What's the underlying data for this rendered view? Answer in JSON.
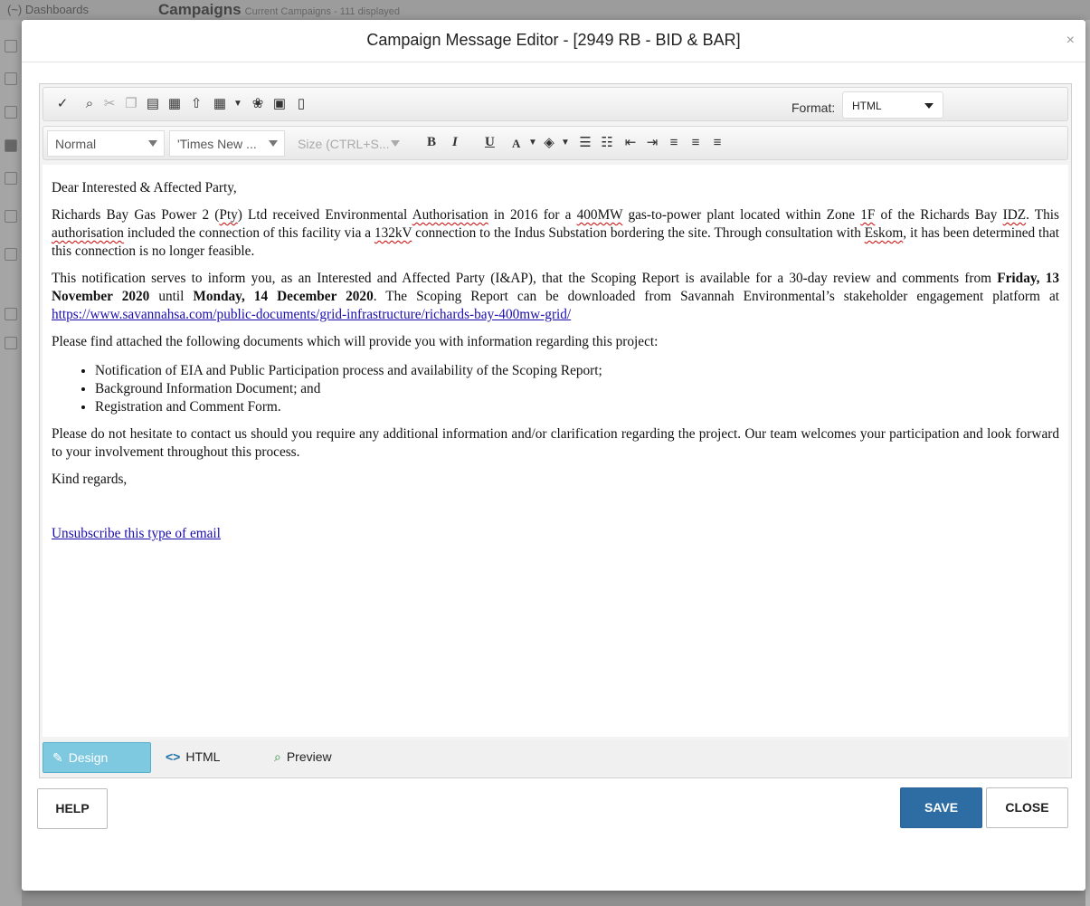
{
  "background": {
    "breadcrumb": "Dashboards",
    "page_title": "Campaigns",
    "page_subtitle": "Current Campaigns - 111 displayed"
  },
  "modal": {
    "title": "Campaign Message Editor - [2949 RB - BID & BAR]",
    "close_glyph": "×"
  },
  "toolbar": {
    "icons": [
      "spellcheck-icon",
      "find-icon",
      "cut-icon",
      "copy-icon",
      "paste-icon",
      "template-icon",
      "special-char-icon",
      "table-icon",
      "image-manager-icon",
      "image-icon",
      "text-document-icon"
    ],
    "format_label": "Format:",
    "format_value": "HTML",
    "paragraph_style": "Normal",
    "font_name": "'Times New ...",
    "font_size": "Size (CTRL+S..."
  },
  "content": {
    "greeting": "Dear Interested & Affected Party,",
    "p1": {
      "a": "Richards Bay Gas Power 2 (",
      "w1": "Pty",
      "b": ") Ltd received Environmental ",
      "w2": "Authorisation",
      "c": " in 2016 for a ",
      "w3": "400MW",
      "d": " gas-to-power plant located within Zone ",
      "w4": "1F",
      "e": " of the Richards Bay ",
      "w5": "IDZ",
      "f": ".  This ",
      "w6": "authorisation",
      "g": " included the connection of this facility via a ",
      "w7": "132kV",
      "h": " connection to the Indus Substation bordering the site.  Through consultation with ",
      "w8": "Eskom",
      "i": ", it has been determined that this connection is no longer feasible."
    },
    "p2": {
      "a": "This notification serves to inform you, as an Interested and Affected Party (I&AP), that the Scoping Report is available for a 30-day review and comments from ",
      "date1": "Friday, 13 November 2020",
      "b": " until ",
      "date2": "Monday, 14 December 2020",
      "c": ".  The Scoping Report can be downloaded from Savannah Environmental’s stakeholder engagement platform at ",
      "link": "https://www.savannahsa.com/public-documents/grid-infrastructure/richards-bay-400mw-grid/"
    },
    "p3": "Please find attached the following documents which will provide you with information regarding this project:",
    "bullets": [
      "Notification of EIA and Public Participation process and availability of the Scoping Report;",
      "Background Information Document; and",
      "Registration and Comment Form."
    ],
    "p4": "Please do not hesitate to contact us should you require any additional information and/or clarification regarding the project. Our team welcomes your participation and look forward to your involvement throughout this process.",
    "closing": "Kind regards,",
    "unsubscribe": "Unsubscribe this type of email"
  },
  "modes": {
    "design": "Design",
    "html": "HTML",
    "preview": "Preview"
  },
  "buttons": {
    "help": "HELP",
    "save": "SAVE",
    "close": "CLOSE"
  },
  "colors": {
    "save_bg": "#2e6da4",
    "design_tab_bg": "#7ec9e0",
    "link": "#1a0dab"
  }
}
